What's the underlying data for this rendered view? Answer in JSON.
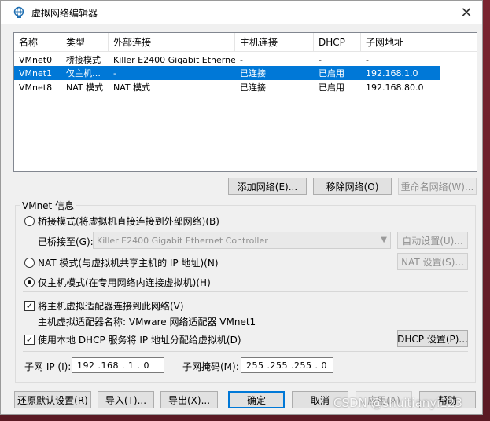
{
  "window": {
    "title": "虚拟网络编辑器",
    "close_glyph": "✕"
  },
  "table": {
    "headers": [
      "名称",
      "类型",
      "外部连接",
      "主机连接",
      "DHCP",
      "子网地址"
    ],
    "rows": [
      [
        "VMnet0",
        "桥接模式",
        "Killer E2400 Gigabit Ethernet…",
        "-",
        "-",
        "-"
      ],
      [
        "VMnet1",
        "仅主机…",
        "-",
        "已连接",
        "已启用",
        "192.168.1.0"
      ],
      [
        "VMnet8",
        "NAT 模式",
        "NAT 模式",
        "已连接",
        "已启用",
        "192.168.80.0"
      ]
    ],
    "selected_index": 1
  },
  "list_buttons": {
    "add": "添加网络(E)...",
    "remove": "移除网络(O)",
    "rename": "重命名网络(W)..."
  },
  "vmnet_info": {
    "group_title": "VMnet 信息",
    "bridged_label": "桥接模式(将虚拟机直接连接到外部网络)(B)",
    "bridged_to_label": "已桥接至(G):",
    "bridged_to_value": "Killer E2400 Gigabit Ethernet Controller",
    "auto_settings": "自动设置(U)...",
    "nat_label": "NAT 模式(与虚拟机共享主机的 IP 地址)(N)",
    "nat_settings": "NAT 设置(S)...",
    "hostonly_label": "仅主机模式(在专用网络内连接虚拟机)(H)",
    "selected_mode": "hostonly",
    "connect_adapter_label": "将主机虚拟适配器连接到此网络(V)",
    "connect_adapter_checked": true,
    "adapter_name_label": "主机虚拟适配器名称: VMware 网络适配器 VMnet1",
    "dhcp_label": "使用本地 DHCP 服务将 IP 地址分配给虚拟机(D)",
    "dhcp_checked": true,
    "dhcp_settings": "DHCP 设置(P)...",
    "subnet_ip_label": "子网 IP (I):",
    "subnet_ip_value": "192 .168 . 1 . 0",
    "subnet_mask_label": "子网掩码(M):",
    "subnet_mask_value": "255 .255 .255 . 0"
  },
  "footer_buttons": {
    "restore": "还原默认设置(R)",
    "import": "导入(T)...",
    "export": "导出(X)...",
    "ok": "确定",
    "cancel": "取消",
    "apply": "应用(A)",
    "help": "帮助"
  },
  "watermark": "CSDN @shuitianyi123",
  "colors": {
    "selection": "#0078d7",
    "desktop": "#6b1f2a"
  }
}
